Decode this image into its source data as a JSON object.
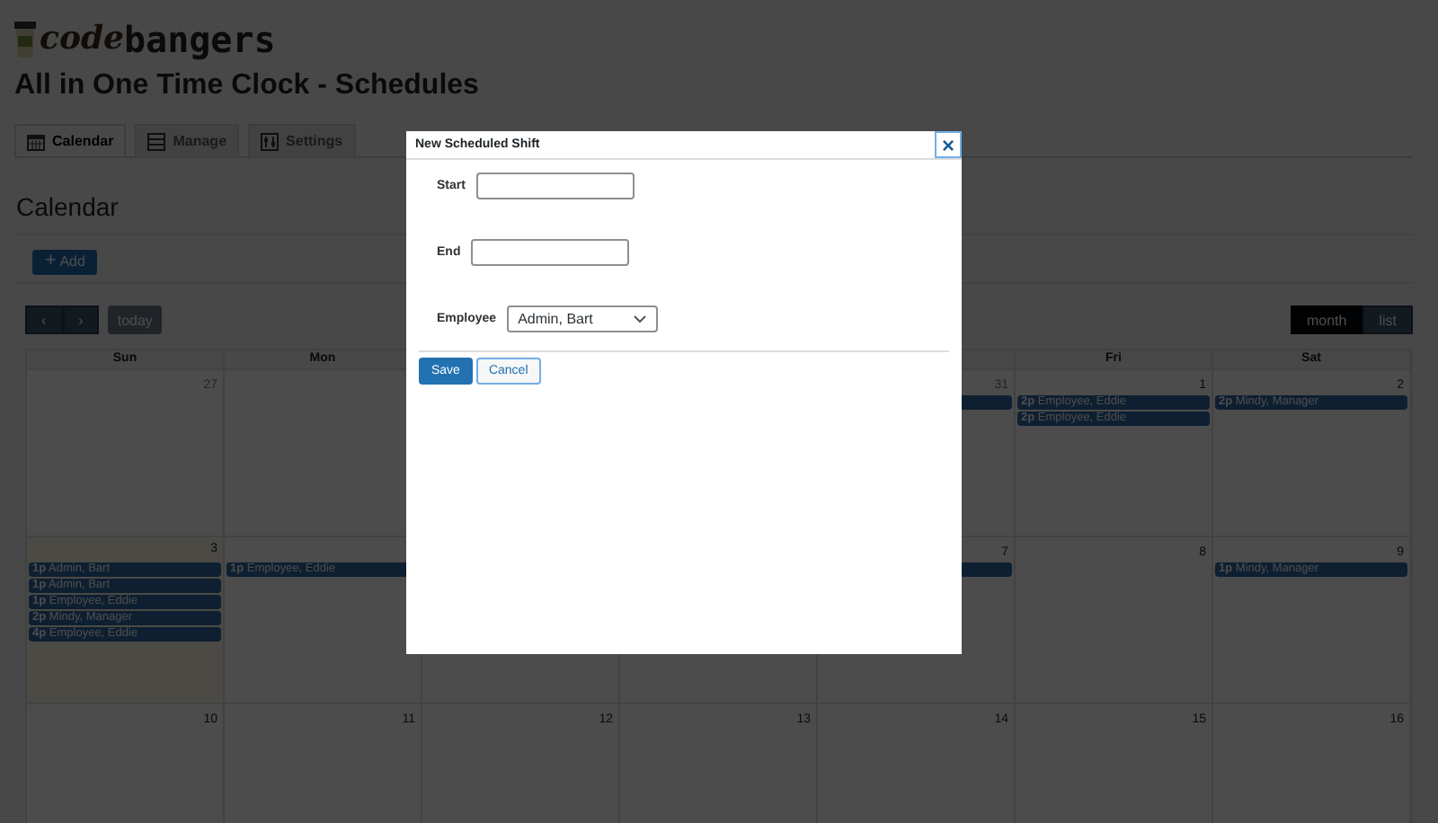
{
  "logo": {
    "text_styled": "code",
    "text_plain": "bangers"
  },
  "page_title": "All in One Time Clock - Schedules",
  "tabs": [
    {
      "label": "Calendar",
      "selected": true
    },
    {
      "label": "Manage",
      "selected": false
    },
    {
      "label": "Settings",
      "selected": false
    }
  ],
  "section_title": "Calendar",
  "add_button": {
    "icon": "+",
    "label": "Add"
  },
  "toolbar": {
    "prev": "‹",
    "next": "›",
    "today": "today",
    "views": [
      {
        "label": "month",
        "selected": true
      },
      {
        "label": "list",
        "selected": false
      }
    ]
  },
  "calendar": {
    "headers_left": [
      "Sun",
      "Mon"
    ],
    "headers_right": [
      "Fri",
      "Sat"
    ],
    "weeks": [
      {
        "days_left": [
          {
            "date": "27",
            "other_month": true
          }
        ],
        "days_right": [
          {
            "date": "31",
            "other_month": true,
            "events": [
              {
                "kind": "covered"
              }
            ]
          },
          {
            "date": "1",
            "other_month": false,
            "events": [
              {
                "time": "2p",
                "name": "Employee, Eddie"
              },
              {
                "time": "2p",
                "name": "Employee, Eddie"
              }
            ]
          },
          {
            "date": "2",
            "other_month": false,
            "events": [
              {
                "time": "2p",
                "name": "Mindy, Manager"
              }
            ]
          }
        ]
      },
      {
        "days_left": [
          {
            "date": "3",
            "other_month": false,
            "today": true,
            "events": [
              {
                "time": "1p",
                "name": "Admin, Bart"
              },
              {
                "time": "1p",
                "name": "Admin, Bart"
              },
              {
                "time": "1p",
                "name": "Employee, Eddie"
              },
              {
                "time": "2p",
                "name": "Mindy, Manager"
              },
              {
                "time": "4p",
                "name": "Employee, Eddie"
              }
            ]
          },
          {
            "events": [
              {
                "time": "1p",
                "name": "Employee, Eddie"
              }
            ]
          }
        ],
        "days_right": [
          {
            "date": "7",
            "other_month": false,
            "events": [
              {
                "kind": "covered"
              }
            ]
          },
          {
            "date": "8",
            "other_month": false
          },
          {
            "date": "9",
            "other_month": false,
            "events": [
              {
                "time": "1p",
                "name": "Mindy, Manager"
              }
            ]
          }
        ]
      },
      {
        "days_left": [
          {
            "date": "10",
            "other_month": false
          },
          {
            "date": "11",
            "other_month": false
          },
          {
            "date": "12",
            "other_month": false
          },
          {
            "date": "13",
            "other_month": false
          },
          {
            "date": "14",
            "other_month": false
          },
          {
            "date": "15",
            "other_month": false
          },
          {
            "date": "16",
            "other_month": false
          }
        ]
      }
    ]
  },
  "modal": {
    "title": "New Scheduled Shift",
    "close": "×",
    "fields": [
      {
        "label": "Start",
        "kind": "text"
      },
      {
        "label": "End",
        "kind": "text"
      },
      {
        "label": "Employee",
        "kind": "select",
        "value": "Admin, Bart"
      }
    ],
    "buttons": [
      {
        "label": "Save",
        "kind": "primary"
      },
      {
        "label": "Cancel",
        "kind": "secondary"
      }
    ]
  }
}
